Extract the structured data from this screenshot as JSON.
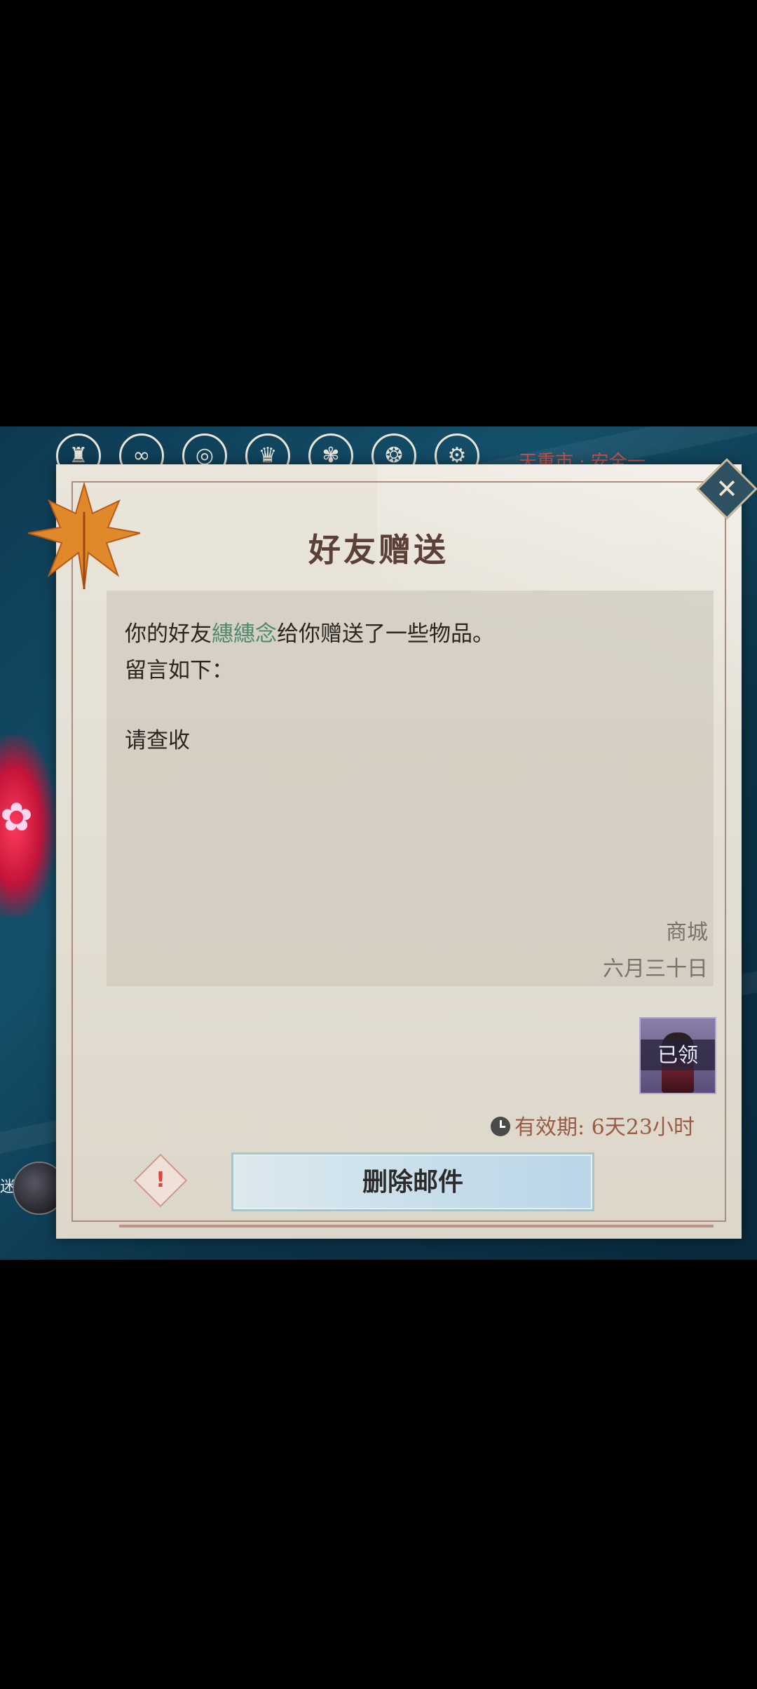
{
  "hud": {
    "icons": [
      "seal-icon",
      "swirl-icon",
      "ring-icon",
      "wing-icon",
      "spiral-icon",
      "orb-icon",
      "gear-icon",
      "lamp-icon"
    ],
    "status_text": "天重市 · 安全一",
    "side_glyph": "迷"
  },
  "mail": {
    "title": "好友赠送",
    "line1_prefix": "你的好友",
    "friend_name": "繐繐念",
    "line1_suffix": "给你赠送了一些物品。",
    "line2": "留言如下：",
    "message": "请查收",
    "sender": "商城",
    "date": "六月三十日",
    "item_status": "已领",
    "validity": "有效期: 6天23小时",
    "delete_label": "删除邮件",
    "report_symbol": "!",
    "close_symbol": "✕"
  },
  "colors": {
    "friend_name": "#4f8a6e",
    "validity": "#9a5a45",
    "title": "#5a4036"
  }
}
